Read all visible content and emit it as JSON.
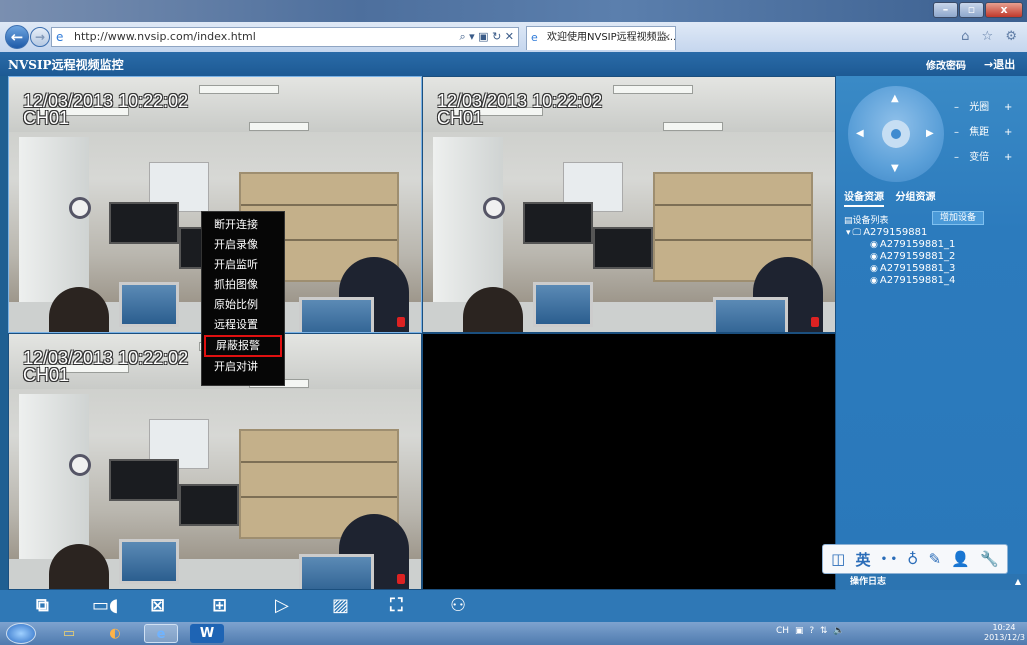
{
  "browser": {
    "url": "http://www.nvsip.com/index.html",
    "tab_title": "欢迎使用NVSIP远程视频监...",
    "tab_close": "×",
    "win_min": "–",
    "win_max": "▫",
    "win_close": "x",
    "addr_controls": "⌕ ▾ ▣ ↻ ✕",
    "right_icons": "⌂ ☆ ⚙"
  },
  "app": {
    "title": "NVSIP远程视频监控",
    "change_password": "修改密码",
    "logout": "退出",
    "logout_icon": "→"
  },
  "video": {
    "cells": [
      {
        "timestamp": "12/03/2013 10:22:02",
        "channel": "CH01"
      },
      {
        "timestamp": "12/03/2013 10:22:02",
        "channel": "CH01"
      },
      {
        "timestamp": "12/03/2013 10:22:02",
        "channel": "CH01"
      }
    ]
  },
  "context_menu": {
    "items": [
      "断开连接",
      "开启录像",
      "开启监听",
      "抓拍图像",
      "原始比例",
      "远程设置",
      "屏蔽报警",
      "开启对讲"
    ],
    "highlighted": "屏蔽报警"
  },
  "ptz": {
    "rows": [
      {
        "label": "光圈",
        "minus": "–",
        "plus": "+"
      },
      {
        "label": "焦距",
        "minus": "–",
        "plus": "+"
      },
      {
        "label": "变倍",
        "minus": "–",
        "plus": "+"
      }
    ]
  },
  "resources": {
    "tabs": [
      "设备资源",
      "分组资源"
    ],
    "active_tab": "设备资源",
    "device_list_label": "设备列表",
    "add_device": "增加设备",
    "device": "A279159881",
    "channels": [
      "A279159881_1",
      "A279159881_2",
      "A279159881_3",
      "A279159881_4"
    ]
  },
  "toolbox": {
    "icons": [
      "screenshot-icon",
      "ime-icon",
      "dots-icon",
      "mic-icon",
      "edit-icon",
      "user-icon",
      "wrench-icon"
    ],
    "ime_label": "英"
  },
  "log": {
    "label": "操作日志",
    "toggle": "▲"
  },
  "bottom_toolbar": {
    "buttons": [
      "close-all-icon",
      "record-icon",
      "close-video-icon",
      "layout-icon",
      "play-icon",
      "image-icon",
      "fullscreen-icon",
      "group-icon"
    ]
  },
  "taskbar": {
    "tray_lang": "CH",
    "time": "10:24",
    "date": "2013/12/3"
  },
  "colors": {
    "accent": "#2c7bbd",
    "header": "#1d5a94",
    "highlight_border": "#e01010"
  }
}
